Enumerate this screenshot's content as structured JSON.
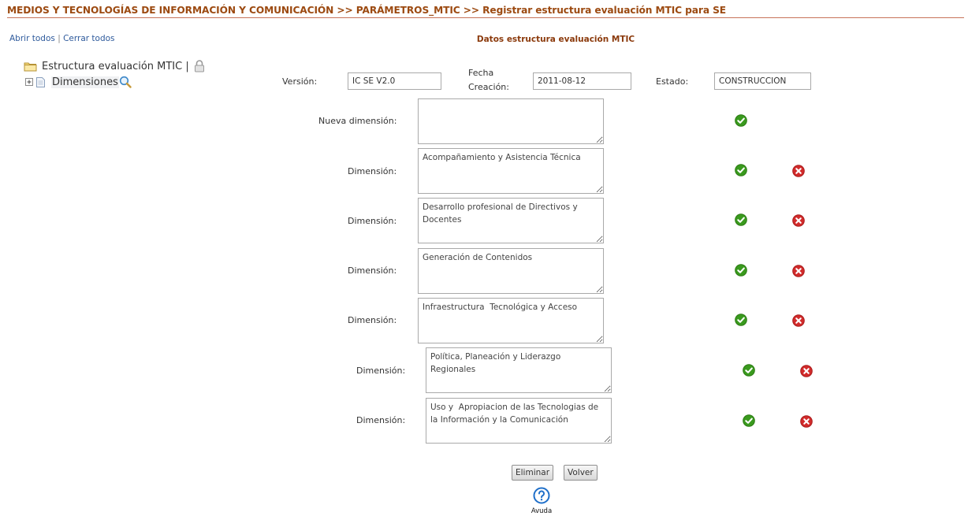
{
  "breadcrumb": "MEDIOS Y TECNOLOGÍAS DE INFORMACIÓN Y COMUNICACIÓN >> PARÁMETROS_MTIC >> Registrar estructura evaluación MTIC para SE",
  "links": {
    "open_all": "Abrir todos",
    "separator": "|",
    "close_all": "Cerrar todos"
  },
  "section_title": "Datos estructura evaluación MTIC",
  "tree": {
    "root_label": "Estructura evaluación MTIC |",
    "child_label": "Dimensiones",
    "icons": [
      "folder-icon",
      "lock-icon",
      "expand-icon",
      "document-icon",
      "magnify-icon"
    ]
  },
  "form": {
    "version_label": "Versión:",
    "version_value": "IC SE V2.0",
    "fecha_label_line1": "Fecha",
    "fecha_label_line2": "Creación:",
    "fecha_value": "2011-08-12",
    "estado_label": "Estado:",
    "estado_value": "CONSTRUCCIÓN",
    "new_dimension_label": "Nueva dimensión:",
    "new_dimension_value": ""
  },
  "dimension_label": "Dimensión:",
  "dimensions": [
    {
      "label": "Dimensión:",
      "value": "Acompañamiento y Asistencia Técnica"
    },
    {
      "label": "Dimensión:",
      "value": "Desarrollo profesional de Directivos y Docentes"
    },
    {
      "label": "Dimensión:",
      "value": "Generación de Contenidos"
    },
    {
      "label": "Dimensión:",
      "value": "Infraestructura  Tecnológica y Acceso"
    },
    {
      "label": "Dimensión:",
      "value": "Política, Planeación y Liderazgo Regionales"
    },
    {
      "label": "Dimensión:",
      "value": "Uso y  Apropiacion de las Tecnologias de la Información y la Comunicación"
    }
  ],
  "buttons": {
    "delete": "Eliminar",
    "back": "Volver"
  },
  "help": {
    "label": "Avuda"
  },
  "colors": {
    "breadcrumb": "#9c4a11",
    "section_title": "#8b3a0c",
    "link": "#2e5a9c",
    "ok_green": "#3a9a1e",
    "delete_red": "#d22b2b",
    "help_blue": "#1f6fc9"
  }
}
